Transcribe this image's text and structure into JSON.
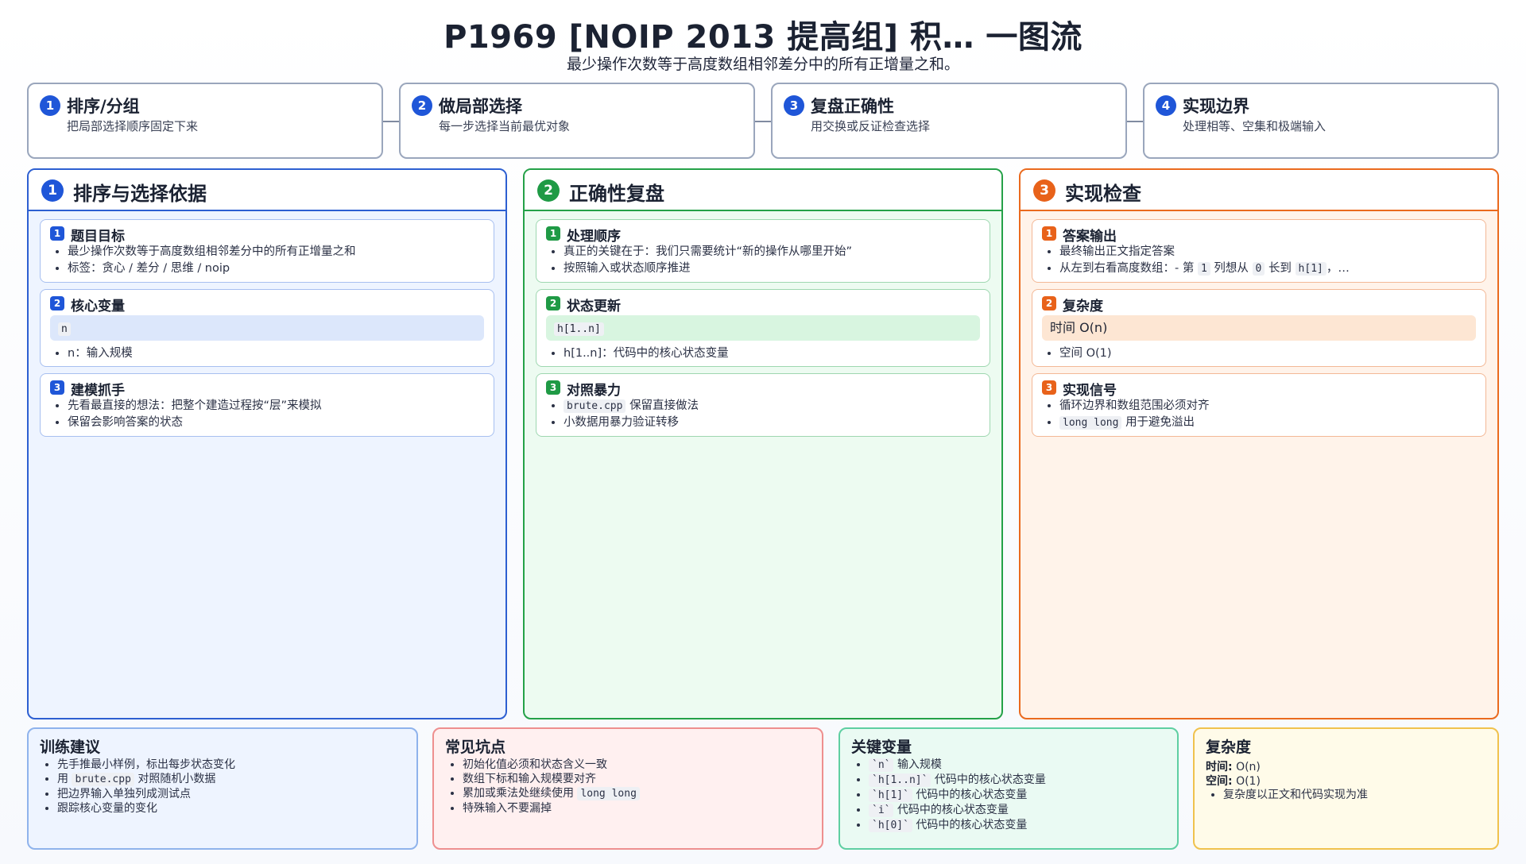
{
  "header": {
    "title": "P1969 [NOIP 2013 提高组] 积… 一图流",
    "subtitle": "最少操作次数等于高度数组相邻差分中的所有正增量之和。"
  },
  "steps": [
    {
      "num": "1",
      "title": "排序/分组",
      "desc": "把局部选择顺序固定下来"
    },
    {
      "num": "2",
      "title": "做局部选择",
      "desc": "每一步选择当前最优对象"
    },
    {
      "num": "3",
      "title": "复盘正确性",
      "desc": "用交换或反证检查选择"
    },
    {
      "num": "4",
      "title": "实现边界",
      "desc": "处理相等、空集和极端输入"
    }
  ],
  "columns": {
    "left": {
      "num": "1",
      "title": "排序与选择依据",
      "cards": [
        {
          "num": "1",
          "title": "题目目标",
          "items": [
            "最少操作次数等于高度数组相邻差分中的所有正增量之和",
            "标签：贪心 / 差分 / 思维 / noip"
          ]
        },
        {
          "num": "2",
          "title": "核心变量",
          "highlight": "n",
          "items": [
            "n：输入规模"
          ]
        },
        {
          "num": "3",
          "title": "建模抓手",
          "items": [
            "先看最直接的想法：把整个建造过程按“层”来模拟",
            "保留会影响答案的状态"
          ]
        }
      ]
    },
    "middle": {
      "num": "2",
      "title": "正确性复盘",
      "cards": [
        {
          "num": "1",
          "title": "处理顺序",
          "items": [
            "真正的关键在于：我们只需要统计“新的操作从哪里开始”",
            "按照输入或状态顺序推进"
          ]
        },
        {
          "num": "2",
          "title": "状态更新",
          "highlight": "h[1..n]",
          "items": [
            "h[1..n]：代码中的核心状态变量"
          ]
        },
        {
          "num": "3",
          "title": "对照暴力",
          "code": "brute.cpp",
          "item1_rest": "保留直接做法",
          "item2": "小数据用暴力验证转移"
        }
      ]
    },
    "right": {
      "num": "3",
      "title": "实现检查",
      "cards": [
        {
          "num": "1",
          "title": "答案输出",
          "item1": "最终输出正文指定答案",
          "item2_a": "从左到右看高度数组：- 第",
          "item2_c1": "1",
          "item2_b": "列想从",
          "item2_c2": "0",
          "item2_d": "长到",
          "item2_c3": "h[1]",
          "item2_e": "，…"
        },
        {
          "num": "2",
          "title": "复杂度",
          "highlight": "时间 O(n)",
          "items": [
            "空间 O(1)"
          ]
        },
        {
          "num": "3",
          "title": "实现信号",
          "item1": "循环边界和数组范围必须对齐",
          "code": "long long",
          "item2_rest": "用于避免溢出"
        }
      ]
    }
  },
  "bottom": {
    "training": {
      "title": "训练建议",
      "i1": "先手推最小样例，标出每步状态变化",
      "i2_a": "用",
      "i2_code": "brute.cpp",
      "i2_b": "对照随机小数据",
      "i3": "把边界输入单独列成测试点",
      "i4": "跟踪核心变量的变化"
    },
    "pitfalls": {
      "title": "常见坑点",
      "i1": "初始化值必须和状态含义一致",
      "i2": "数组下标和输入规模要对齐",
      "i3_a": "累加或乘法处继续使用",
      "i3_code": "long long",
      "i4": "特殊输入不要漏掉"
    },
    "variables": {
      "title": "关键变量",
      "items": [
        {
          "code": "`n`",
          "desc": "输入规模"
        },
        {
          "code": "`h[1..n]`",
          "desc": "代码中的核心状态变量"
        },
        {
          "code": "`h[1]`",
          "desc": "代码中的核心状态变量"
        },
        {
          "code": "`i`",
          "desc": "代码中的核心状态变量"
        },
        {
          "code": "`h[0]`",
          "desc": "代码中的核心状态变量"
        }
      ]
    },
    "complexity": {
      "title": "复杂度",
      "time_label": "时间:",
      "time": "O(n)",
      "space_label": "空间:",
      "space": "O(1)",
      "note": "复杂度以正文和代码实现为准"
    }
  },
  "colors": {
    "blue": "#1f56d8",
    "green": "#1f9a45",
    "orange": "#e8621a",
    "red": "#e05252",
    "teal": "#24a87a",
    "amber": "#e0a52a"
  }
}
